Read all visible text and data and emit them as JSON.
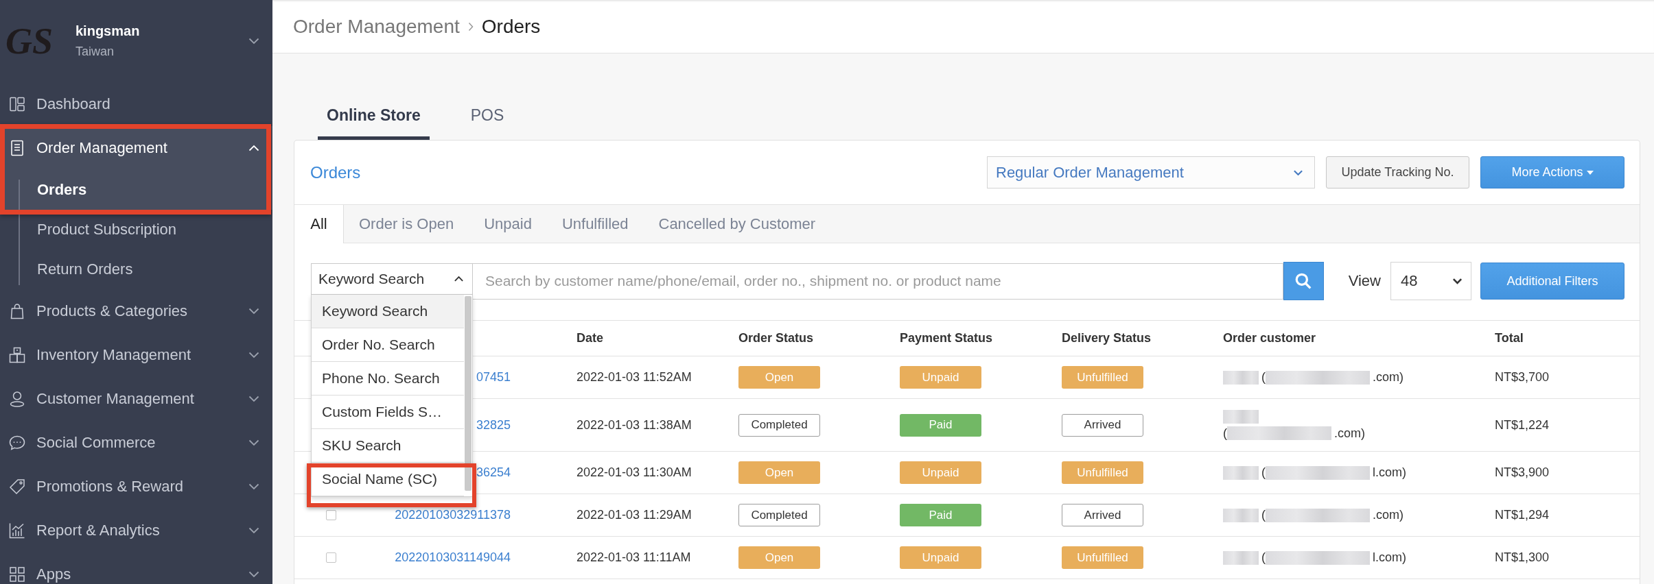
{
  "sidebar": {
    "logo": "GS",
    "store_name": "kingsman",
    "store_region": "Taiwan",
    "items": [
      {
        "label": "Dashboard",
        "selected": false,
        "annotated": false
      },
      {
        "label": "Order Management",
        "selected": true,
        "expanded": true,
        "annotated": true,
        "children": [
          {
            "label": "Orders",
            "selected": true
          },
          {
            "label": "Product Subscription",
            "selected": false
          },
          {
            "label": "Return Orders",
            "selected": false
          }
        ]
      },
      {
        "label": "Products & Categories",
        "selected": false,
        "expanded": false,
        "annotated": false
      },
      {
        "label": "Inventory Management",
        "selected": false,
        "expanded": false,
        "annotated": false
      },
      {
        "label": "Customer Management",
        "selected": false,
        "expanded": false,
        "annotated": false
      },
      {
        "label": "Social Commerce",
        "selected": false,
        "expanded": false,
        "annotated": false
      },
      {
        "label": "Promotions & Reward",
        "selected": false,
        "expanded": false,
        "annotated": false
      },
      {
        "label": "Report & Analytics",
        "selected": false,
        "expanded": false,
        "annotated": false
      },
      {
        "label": "Apps",
        "selected": false,
        "expanded": false,
        "annotated": false
      }
    ]
  },
  "breadcrumb": [
    "Order Management",
    "Orders"
  ],
  "tabs": [
    {
      "label": "Online Store",
      "selected": true
    },
    {
      "label": "POS",
      "selected": false
    }
  ],
  "orders_panel": {
    "title": "Orders",
    "view_select": "Regular Order Management",
    "buttons": [
      {
        "label": "Update Tracking No.",
        "kind": "default"
      },
      {
        "label": "More Actions",
        "kind": "dropdown"
      }
    ],
    "filter_tabs": [
      {
        "label": "All",
        "selected": true
      },
      {
        "label": "Order is Open",
        "selected": false
      },
      {
        "label": "Unpaid",
        "selected": false
      },
      {
        "label": "Unfulfilled",
        "selected": false
      },
      {
        "label": "Cancelled by Customer",
        "selected": false
      }
    ],
    "search": {
      "mode": {
        "value": "Keyword Search",
        "expanded": true,
        "options": [
          {
            "label": "Keyword Search",
            "selected": true,
            "annotated": false
          },
          {
            "label": "Order No. Search",
            "selected": false,
            "annotated": false
          },
          {
            "label": "Phone No. Search",
            "selected": false,
            "annotated": false
          },
          {
            "label": "Custom Fields S…",
            "selected": false,
            "annotated": false
          },
          {
            "label": "SKU Search",
            "selected": false,
            "annotated": false
          },
          {
            "label": "Social Name (SC)",
            "selected": false,
            "annotated": true
          }
        ]
      },
      "placeholder": "Search by customer name/phone/email, order no., shipment no. or product name",
      "view_label": "View",
      "page_size": "48",
      "filters_button": "Additional Filters"
    },
    "table": {
      "columns": [
        "Date",
        "Order Status",
        "Payment Status",
        "Delivery Status",
        "Order customer",
        "Total"
      ],
      "rows": [
        {
          "order_no": "07451",
          "date": "2022-01-03 11:52AM",
          "order_status": {
            "label": "Open",
            "kind": "warning"
          },
          "payment_status": {
            "label": "Unpaid",
            "kind": "warning"
          },
          "delivery_status": {
            "label": "Unfulfilled",
            "kind": "warning"
          },
          "customer": [
            [
              {
                "kind": "redacted_name"
              },
              {
                "kind": "text",
                "text": "("
              },
              {
                "kind": "redacted_email"
              },
              {
                "kind": "text",
                "text": ".com)"
              }
            ]
          ],
          "total": "NT$3,700"
        },
        {
          "order_no": "32825",
          "date": "2022-01-03 11:38AM",
          "order_status": {
            "label": "Completed",
            "kind": "plain"
          },
          "payment_status": {
            "label": "Paid",
            "kind": "success"
          },
          "delivery_status": {
            "label": "Arrived",
            "kind": "plain"
          },
          "customer": [
            [
              {
                "kind": "redacted_name"
              }
            ],
            [
              {
                "kind": "text",
                "text": "("
              },
              {
                "kind": "redacted_email"
              },
              {
                "kind": "text",
                "text": ".com)"
              }
            ]
          ],
          "total": "NT$1,224"
        },
        {
          "order_no": "36254",
          "date": "2022-01-03 11:30AM",
          "order_status": {
            "label": "Open",
            "kind": "warning"
          },
          "payment_status": {
            "label": "Unpaid",
            "kind": "warning"
          },
          "delivery_status": {
            "label": "Unfulfilled",
            "kind": "warning"
          },
          "customer": [
            [
              {
                "kind": "redacted_name"
              },
              {
                "kind": "text",
                "text": "("
              },
              {
                "kind": "redacted_email"
              },
              {
                "kind": "text",
                "text": "l.com)"
              }
            ]
          ],
          "total": "NT$3,900"
        },
        {
          "checked": false,
          "order_no": "20220103032911378",
          "date": "2022-01-03 11:29AM",
          "order_status": {
            "label": "Completed",
            "kind": "plain"
          },
          "payment_status": {
            "label": "Paid",
            "kind": "success"
          },
          "delivery_status": {
            "label": "Arrived",
            "kind": "plain"
          },
          "customer": [
            [
              {
                "kind": "redacted_name"
              },
              {
                "kind": "text",
                "text": "("
              },
              {
                "kind": "redacted_email"
              },
              {
                "kind": "text",
                "text": ".com)"
              }
            ]
          ],
          "total": "NT$1,294"
        },
        {
          "checked": false,
          "order_no": "20220103031149044",
          "date": "2022-01-03 11:11AM",
          "order_status": {
            "label": "Open",
            "kind": "warning"
          },
          "payment_status": {
            "label": "Unpaid",
            "kind": "warning"
          },
          "delivery_status": {
            "label": "Unfulfilled",
            "kind": "warning"
          },
          "customer": [
            [
              {
                "kind": "redacted_name"
              },
              {
                "kind": "text",
                "text": "("
              },
              {
                "kind": "redacted_email"
              },
              {
                "kind": "text",
                "text": "l.com)"
              }
            ]
          ],
          "total": "NT$1,300"
        }
      ]
    }
  }
}
